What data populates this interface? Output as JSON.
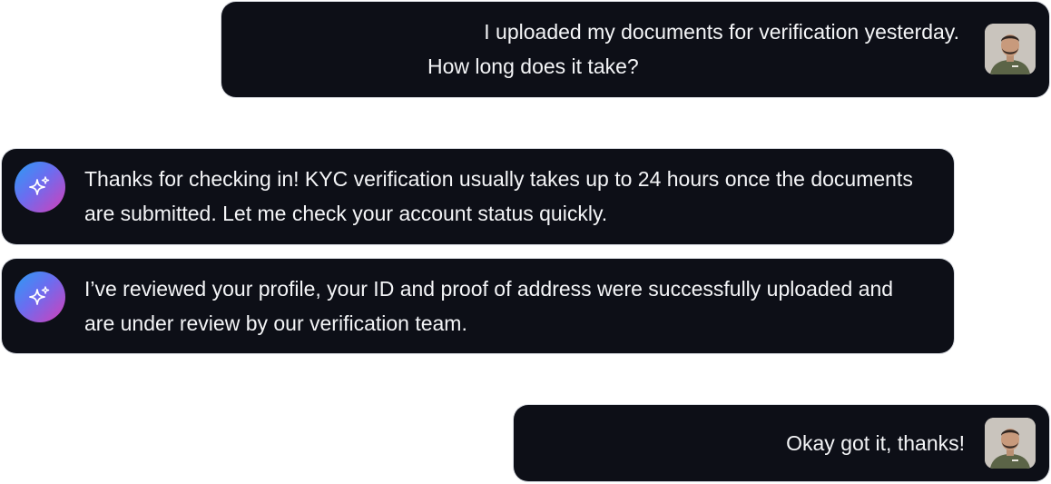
{
  "colors": {
    "bubble_bg": "#0d0f17",
    "text": "#f4f5f7",
    "badge_gradient": [
      "#2a9df4",
      "#6b6df0",
      "#d43fb8"
    ],
    "avatar_bg": "#c9c4bd",
    "shirt": "#5b6447"
  },
  "messages": [
    {
      "role": "user",
      "lines": [
        "I uploaded my documents for verification yesterday.",
        "How long does it take?"
      ],
      "icon": "user-avatar"
    },
    {
      "role": "assistant",
      "text": "Thanks for checking in! KYC verification usually takes up to 24 hours once the documents are submitted. Let me check your account status quickly.",
      "icon": "sparkle-icon"
    },
    {
      "role": "assistant",
      "text": "I’ve reviewed your profile, your ID and proof of address were successfully uploaded and are under review by our verification team.",
      "icon": "sparkle-icon"
    },
    {
      "role": "user",
      "text": "Okay got it, thanks!",
      "icon": "user-avatar"
    }
  ]
}
